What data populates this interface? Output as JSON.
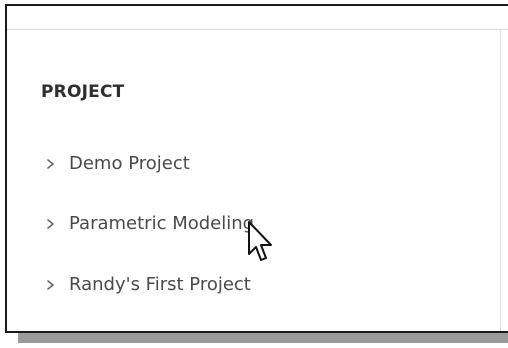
{
  "sidebar": {
    "section_title": "PROJECT",
    "items": [
      {
        "label": "Demo Project",
        "icon": "chevron-right-icon"
      },
      {
        "label": "Parametric Modeling",
        "icon": "chevron-right-icon"
      },
      {
        "label": "Randy's First Project",
        "icon": "chevron-right-icon"
      }
    ]
  },
  "cursor": {
    "icon": "mouse-pointer-icon"
  },
  "colors": {
    "frame_border": "#1b1b1b",
    "title_text": "#2f2f2f",
    "item_text": "#4a4a4a",
    "divider": "#e2e2e2",
    "shadow": "#9a9a9a"
  }
}
